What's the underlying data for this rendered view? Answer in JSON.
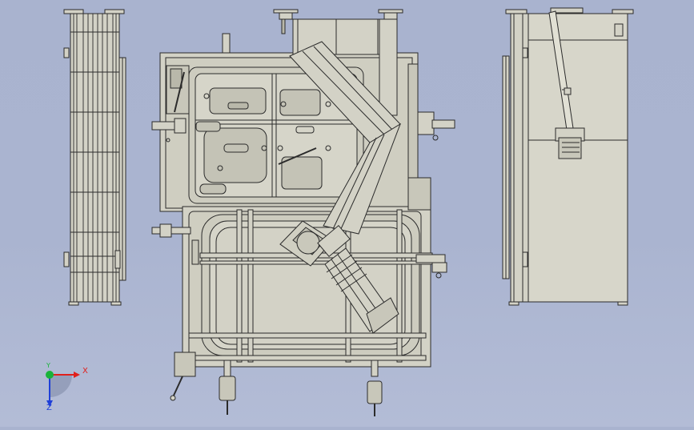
{
  "colors": {
    "background": "#aab4d0",
    "part_fill": "#d3d2c6",
    "part_fill_dark": "#b9b8aa",
    "edge": "#2b2b2b",
    "axis_x": "#e0201c",
    "axis_y": "#19b33a",
    "axis_z": "#1f3fd8"
  },
  "triad": {
    "x_label": "X",
    "y_label": "Y",
    "z_label": "Z"
  },
  "views": [
    "left-side-view",
    "front-view",
    "right-side-view"
  ],
  "icons": {
    "axis_triad": "coordinate-triad-icon"
  }
}
